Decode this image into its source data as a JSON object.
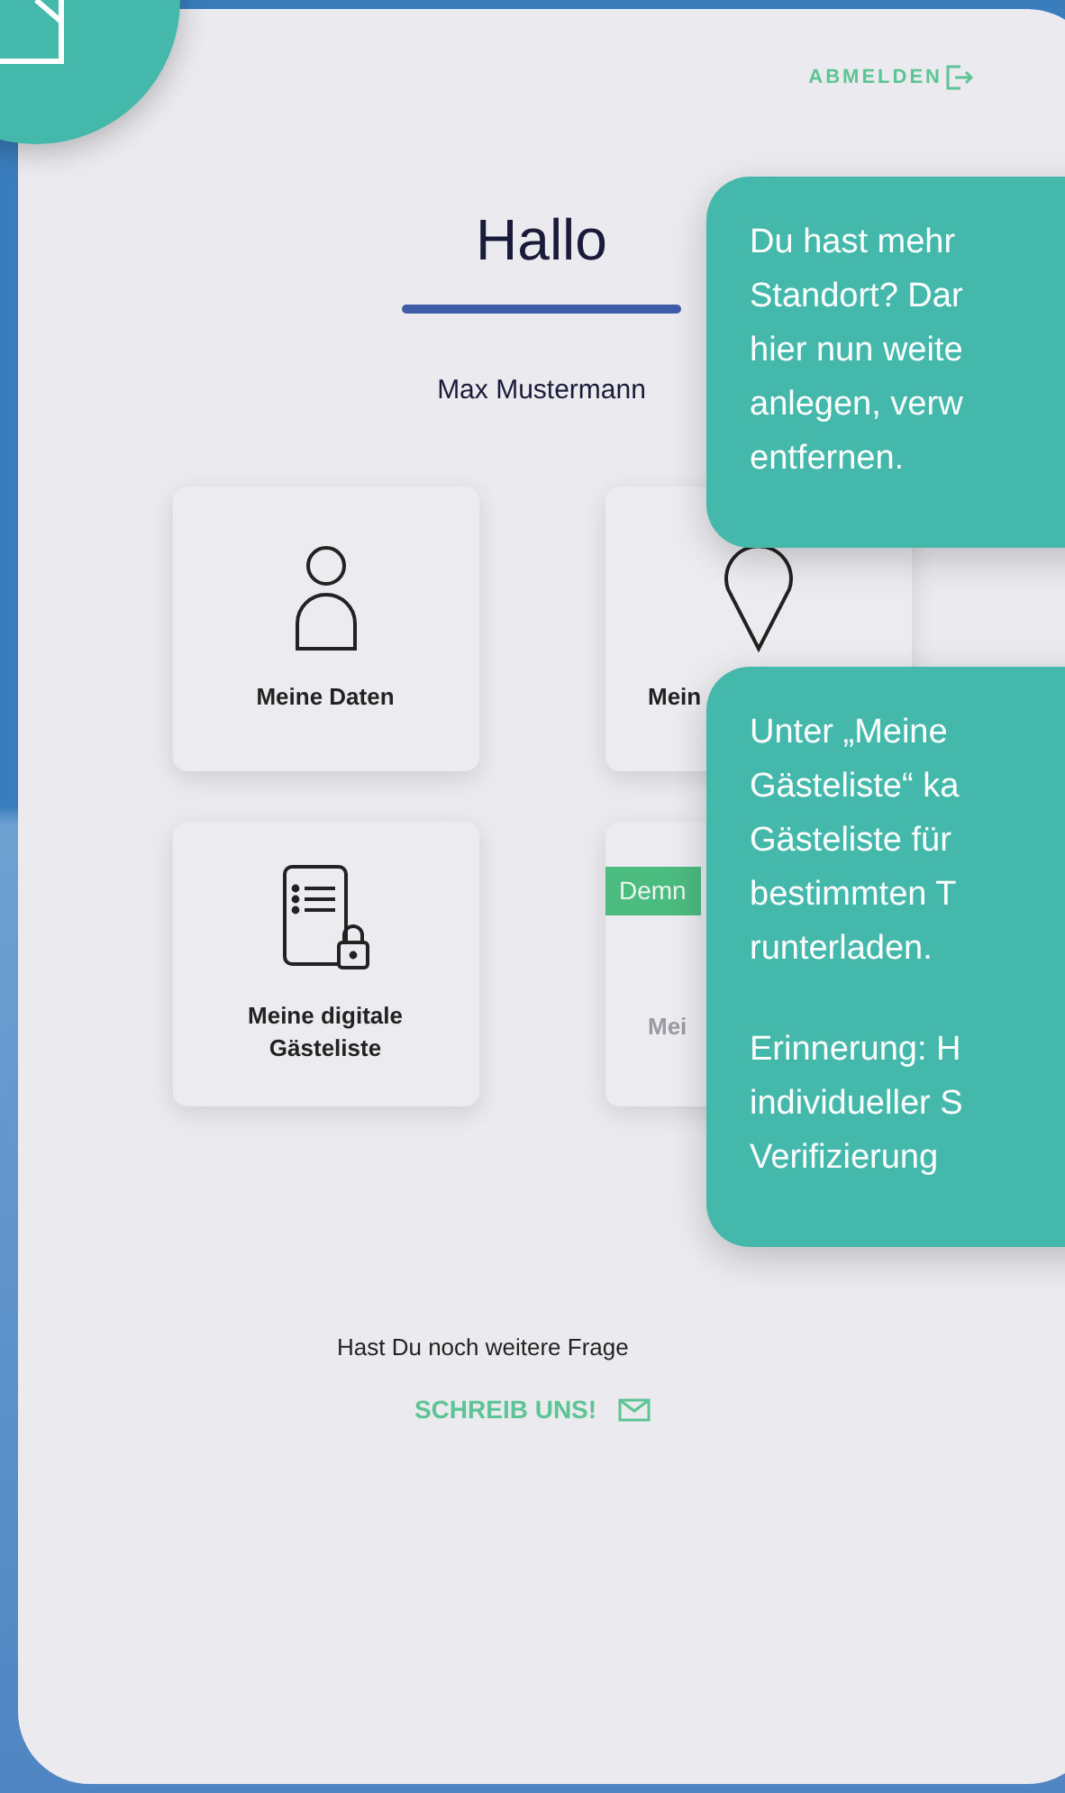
{
  "logout": {
    "label": "ABMELDEN"
  },
  "greeting": {
    "title": "Hallo",
    "name": "Max Mustermann"
  },
  "cards": [
    {
      "kind": "person",
      "label": [
        "Meine Daten"
      ],
      "disabled": false
    },
    {
      "kind": "pin",
      "label": [
        "Mein"
      ],
      "disabled": false
    },
    {
      "kind": "guestlist",
      "label": [
        "Meine digitale",
        "Gästeliste"
      ],
      "disabled": false
    },
    {
      "kind": "other",
      "badge": "Demn",
      "label": [
        "Mei"
      ],
      "disabled": true
    }
  ],
  "contact": {
    "question": "Hast Du noch weitere Frage",
    "link": "SCHREIB UNS!"
  },
  "tooltips": [
    {
      "paragraphs": [
        [
          "Du hast mehr",
          "Standort? Dar",
          "hier nun weite",
          "anlegen, verw",
          "entfernen."
        ]
      ]
    },
    {
      "paragraphs": [
        [
          "Unter „Meine",
          "Gästeliste“ ka",
          "Gästeliste für",
          "bestimmten T",
          "runterladen."
        ],
        [
          "Erinnerung: H",
          "individueller S",
          "Verifizierung"
        ]
      ]
    }
  ]
}
